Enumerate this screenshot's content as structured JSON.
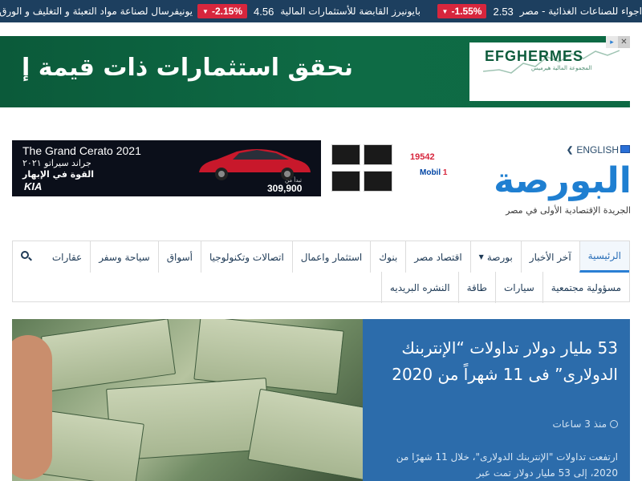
{
  "ticker": {
    "items": [
      {
        "name": "اجواء للصناعات الغذائية - مصر",
        "price": "2.53",
        "change": "-1.55%"
      },
      {
        "name": "بايونيرز القابضة للأستثمارات المالية",
        "price": "4.56",
        "change": "-2.15%"
      },
      {
        "name": "يونيفرسال لصناعة مواد التعبئة و التغليف و الورق",
        "price": "",
        "change": ""
      }
    ],
    "colors": {
      "bar": "#1d3f5f",
      "down_badge": "#d7263d"
    }
  },
  "top_ad": {
    "slogan": "نحقق استثمارات ذات قيمة إ",
    "brand": "EFGHERMES",
    "brand_sub": "المجموعة المالية هيرميس",
    "close_icon": "close-icon",
    "info_icon": "ad-info-icon"
  },
  "header": {
    "car_ad": {
      "headline": "The Grand Cerato 2021",
      "headline_ar": "جراند سيراتو ٢٠٢١",
      "slogan_ar": "القوة في الإبهار",
      "brand": "KIA",
      "price": "309,900",
      "price_prefix": "تبدأ من"
    },
    "oil_ad": {
      "hotline": "19542",
      "brand_prefix": "Mobil",
      "brand_num": "1"
    },
    "logo": {
      "english_link": "ENGLISH",
      "wordmark": "البورصة",
      "tagline": "الجريدة الإقتصادية الأولى في مصر"
    }
  },
  "nav": {
    "row1": [
      {
        "label": "الرئيسية",
        "active": true
      },
      {
        "label": "آخر الأخبار",
        "active": false
      },
      {
        "label": "بورصة",
        "active": false,
        "dropdown": true
      },
      {
        "label": "اقتصاد مصر",
        "active": false
      },
      {
        "label": "بنوك",
        "active": false
      },
      {
        "label": "استثمار واعمال",
        "active": false
      },
      {
        "label": "اتصالات وتكنولوجيا",
        "active": false
      },
      {
        "label": "أسواق",
        "active": false
      },
      {
        "label": "سياحة وسفر",
        "active": false
      },
      {
        "label": "عقارات",
        "active": false
      }
    ],
    "row2": [
      {
        "label": "مسؤولية مجتمعية"
      },
      {
        "label": "سيارات"
      },
      {
        "label": "طاقة"
      },
      {
        "label": "النشره البريديه"
      }
    ],
    "search_icon": "search-icon"
  },
  "feature": {
    "title": "53 مليار دولار تداولات “الإنتربنك الدولارى” فى 11 شهراً من 2020",
    "time": "منذ 3 ساعات",
    "excerpt": "ارتفعت تداولات \"الإنتربنك الدولارى\"، خلال 11 شهرًا من 2020، إلى 53 مليار دولار تمت عبر",
    "accent": "#2c6cab"
  }
}
